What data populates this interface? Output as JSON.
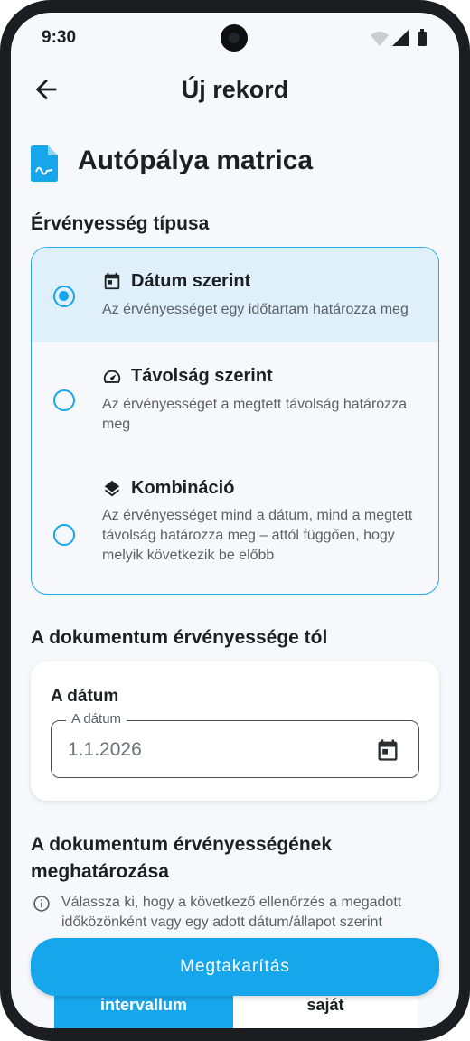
{
  "status": {
    "time": "9:30"
  },
  "appbar": {
    "title": "Új rekord"
  },
  "document": {
    "title": "Autópálya matrica"
  },
  "validity_type": {
    "heading": "Érvényesség típusa",
    "options": [
      {
        "title": "Dátum szerint",
        "description": "Az érvényességet egy időtartam határozza meg",
        "selected": true,
        "icon": "calendar-icon"
      },
      {
        "title": "Távolság szerint",
        "description": "Az érvényességet a megtett távolság határozza meg",
        "selected": false,
        "icon": "speedometer-icon"
      },
      {
        "title": "Kombináció",
        "description": "Az érvényességet mind a dátum, mind a megtett távolság határozza meg – attól függően, hogy melyik következik be előbb",
        "selected": false,
        "icon": "layers-icon"
      }
    ]
  },
  "valid_from": {
    "heading": "A dokumentum érvényessége tól",
    "card_label": "A dátum",
    "field_label": "A dátum",
    "field_value": "1.1.2026"
  },
  "determination": {
    "heading": "A dokumentum érvényességének meghatározása",
    "info_text": "Válassza ki, hogy a következő ellenőrzés a megadott időközönként vagy egy adott dátum/állapot szerint",
    "tabs": [
      "intervallum",
      "saját"
    ]
  },
  "actions": {
    "save_label": "Megtakarítás"
  },
  "colors": {
    "accent": "#16a6ec",
    "selected_bg": "#dff0fb",
    "text": "#1d1f22"
  }
}
